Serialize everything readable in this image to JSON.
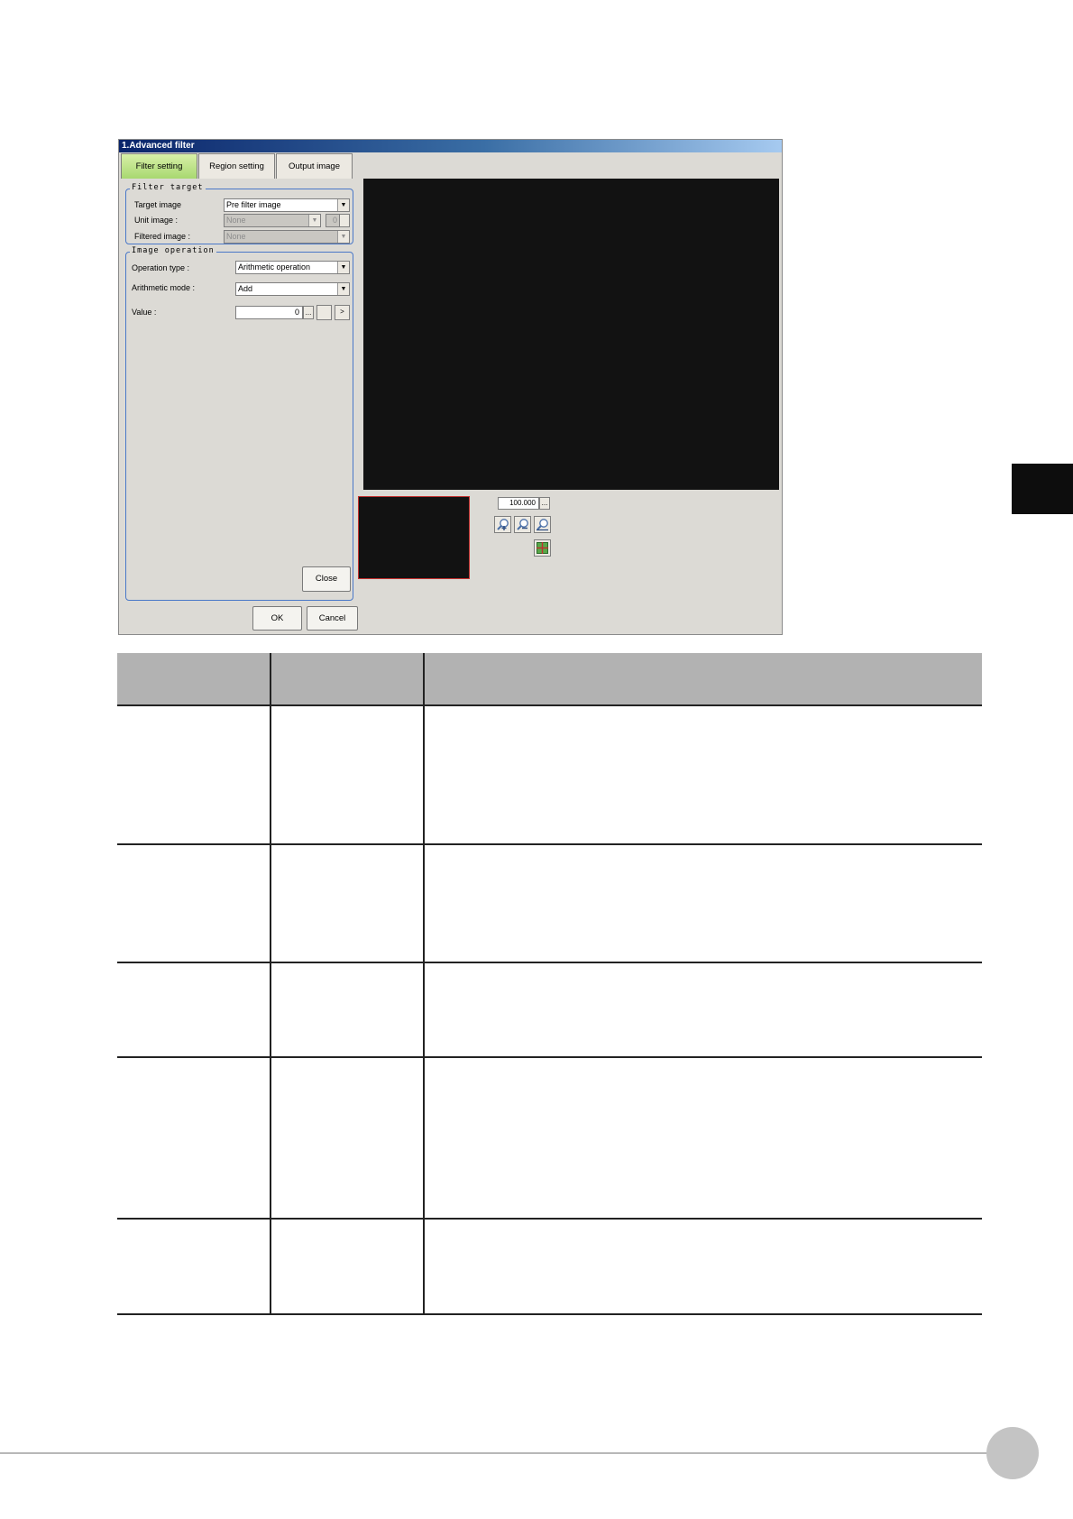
{
  "dialog": {
    "title": "1.Advanced filter",
    "tabs": [
      {
        "label": "Filter setting",
        "active": true
      },
      {
        "label": "Region setting",
        "active": false
      },
      {
        "label": "Output image",
        "active": false
      }
    ],
    "filter_target": {
      "group_title": "Filter target",
      "target_image_label": "Target image",
      "target_image_value": "Pre filter image",
      "unit_image_label": "Unit image :",
      "unit_image_value": "None",
      "unit_image_number": "0",
      "filtered_image_label": "Filtered image :",
      "filtered_image_value": "None"
    },
    "image_operation": {
      "group_title": "Image operation",
      "operation_type_label": "Operation type :",
      "operation_type_value": "Arithmetic operation",
      "arithmetic_mode_label": "Arithmetic mode :",
      "arithmetic_mode_value": "Add",
      "value_label": "Value :",
      "value": "0",
      "ellipsis_label": "...",
      "next_label": ">"
    },
    "close_label": "Close",
    "ok_label": "OK",
    "cancel_label": "Cancel",
    "zoom": {
      "value": "100.000",
      "ellipsis_label": "...",
      "icons": [
        "zoom-in-icon",
        "zoom-out-icon",
        "zoom-fit-icon",
        "fit-frame-icon"
      ]
    }
  },
  "table": {
    "header": [
      "",
      "",
      ""
    ],
    "row_count": 5
  },
  "colors": {
    "active_tab": "#a8d870",
    "group_border": "#4a78c8",
    "image_area": "#121212",
    "nav_border": "#c2302e",
    "table_header": "#b2b2b2"
  }
}
